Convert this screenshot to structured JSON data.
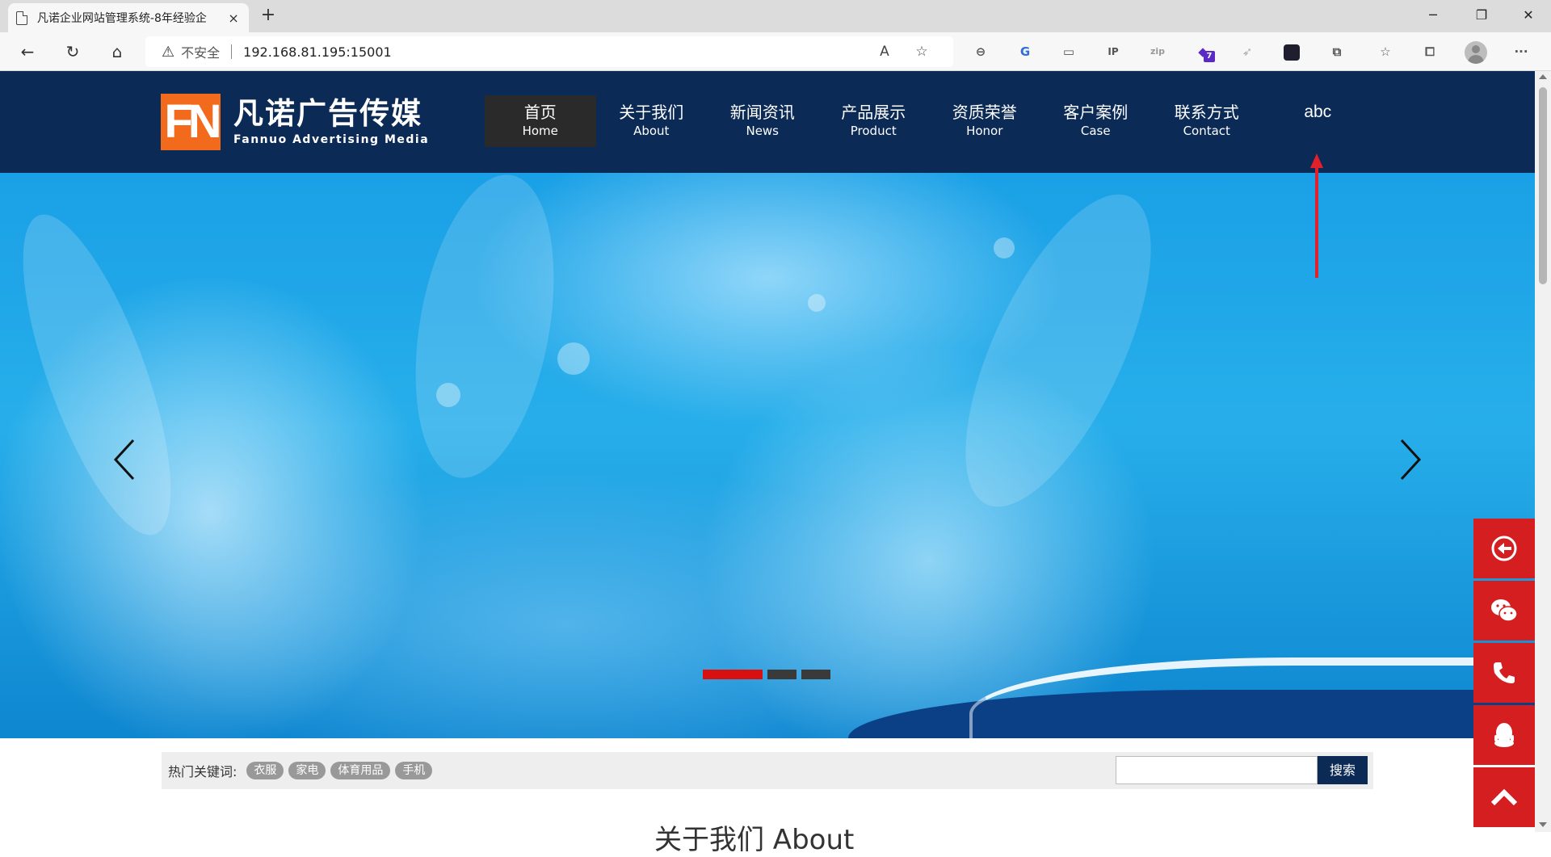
{
  "browser": {
    "tab_title": "凡诺企业网站管理系统-8年经验企",
    "tab_close": "×",
    "new_tab": "+",
    "insecure_label": "不安全",
    "url": "192.168.81.195:15001",
    "extension_badge_count": "7",
    "icons": [
      "back-arrow-icon",
      "refresh-icon",
      "home-icon",
      "warning-icon",
      "read-aloud-icon",
      "add-favorite-icon",
      "minus-circle-icon",
      "translate-icon",
      "monitor-icon",
      "ip-icon",
      "zip-icon",
      "extension-gem-icon",
      "bird-icon",
      "chart-app-icon",
      "puzzle-icon",
      "favorites-icon",
      "collections-icon",
      "profile-icon",
      "more-icon"
    ]
  },
  "site": {
    "logo_mark": "FN",
    "logo_cn": "凡诺广告传媒",
    "logo_en": "Fannuo Advertising Media",
    "nav": [
      {
        "cn": "首页",
        "en": "Home"
      },
      {
        "cn": "关于我们",
        "en": "About"
      },
      {
        "cn": "新闻资讯",
        "en": "News"
      },
      {
        "cn": "产品展示",
        "en": "Product"
      },
      {
        "cn": "资质荣誉",
        "en": "Honor"
      },
      {
        "cn": "客户案例",
        "en": "Case"
      },
      {
        "cn": "联系方式",
        "en": "Contact"
      },
      {
        "cn": "abc",
        "en": ""
      }
    ],
    "active_nav_index": 0,
    "banner": {
      "slide_count": 3,
      "active_slide": 1
    },
    "search": {
      "hot_label": "热门关键词:",
      "keywords": [
        "衣服",
        "家电",
        "体育用品",
        "手机"
      ],
      "input_value": "",
      "button_label": "搜索"
    },
    "section_title": "关于我们 About",
    "float_bar": [
      "back-circle-icon",
      "wechat-icon",
      "phone-icon",
      "qq-icon",
      "scroll-top-icon"
    ]
  },
  "colors": {
    "header_bg": "#0b2a55",
    "logo_accent": "#f26a1b",
    "active_nav_bg": "#2a2a2a",
    "float_bar_red": "#d51e20",
    "slider_active": "#d81010",
    "annotation_arrow": "#e0202a"
  }
}
